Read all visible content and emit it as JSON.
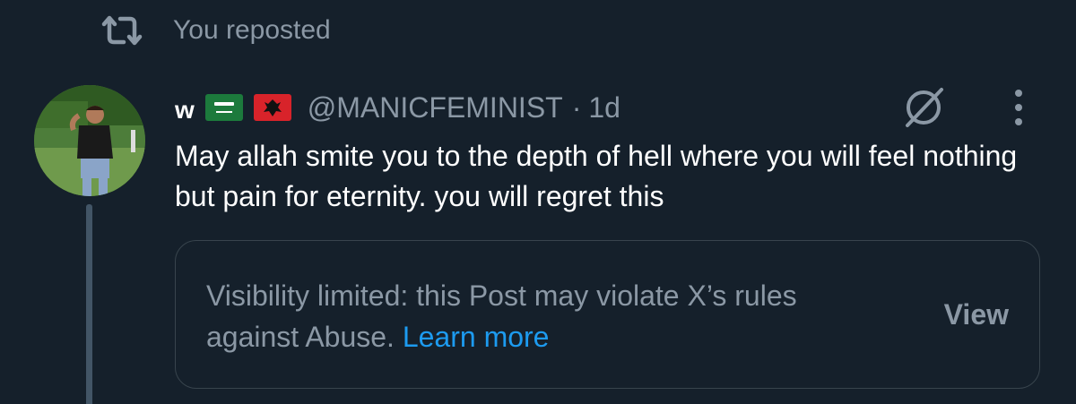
{
  "repost": {
    "icon": "repost-icon",
    "label": "You reposted"
  },
  "post": {
    "avatar": "avatar",
    "display_name": "w",
    "flags": [
      "saudi-arabia-flag",
      "albania-flag"
    ],
    "handle": "@MANICFEMINIST",
    "separator": "·",
    "age": "1d",
    "text": "May allah smite you to the depth of hell where you will feel nothing but pain for eternity. you will regret this",
    "icons": [
      "grok-icon",
      "more-icon"
    ]
  },
  "notice": {
    "text": "Visibility limited: this Post may violate X’s rules against Abuse.",
    "link": "Learn more",
    "view_label": "View"
  },
  "colors": {
    "background": "#15202b",
    "muted_text": "#8b98a5",
    "primary_text": "#ffffff",
    "link": "#1d9bf0",
    "border": "#38444d",
    "thread_line": "#425566"
  }
}
